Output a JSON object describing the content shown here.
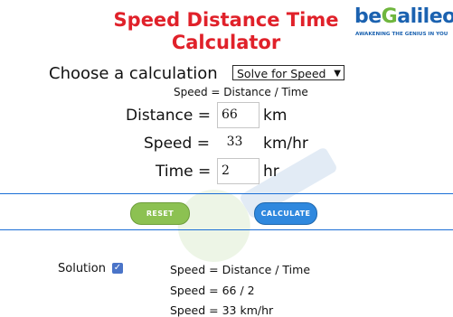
{
  "title_line1": "Speed Distance Time",
  "title_line2": "Calculator",
  "logo": {
    "text_be": "be",
    "text_g": "G",
    "text_rest": "alileo",
    "tagline": "AWAKENING THE GENIUS IN YOU"
  },
  "choose": {
    "label": "Choose a calculation",
    "selected": "Solve for Speed"
  },
  "formula": "Speed = Distance / Time",
  "rows": {
    "distance": {
      "label": "Distance =",
      "value": "66",
      "unit": "km"
    },
    "speed": {
      "label": "Speed =",
      "value": "33",
      "unit": "km/hr"
    },
    "time": {
      "label": "Time =",
      "value": "2",
      "unit": "hr"
    }
  },
  "buttons": {
    "reset": "RESET",
    "calculate": "CALCULATE"
  },
  "solution": {
    "label": "Solution",
    "checked": true,
    "lines": [
      "Speed = Distance / Time",
      "Speed = 66 / 2",
      "Speed = 33 km/hr"
    ]
  },
  "colors": {
    "title": "#e0212a",
    "accent_blue": "#1b6fd6",
    "reset_green": "#8cc152",
    "calculate_blue": "#2f88de"
  }
}
